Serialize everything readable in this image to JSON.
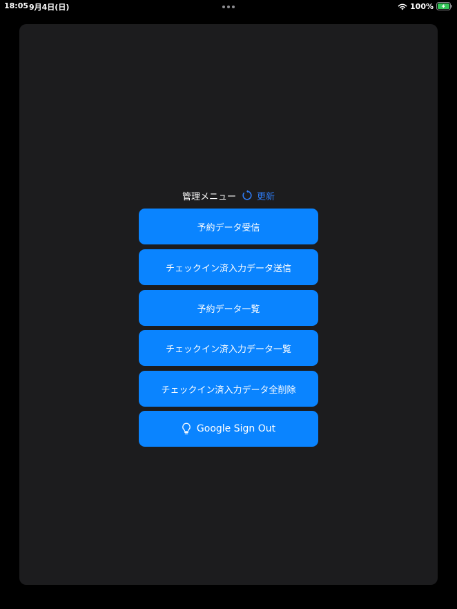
{
  "status_bar": {
    "time": "18:05",
    "date": "9月4日(日)",
    "battery": "100%",
    "icons": [
      "multitask-dots-icon",
      "wifi-icon",
      "battery-charging-icon"
    ]
  },
  "menu": {
    "title": "管理メニュー",
    "refresh_label": "更新",
    "refresh_icon": "refresh-icon"
  },
  "buttons": [
    {
      "label": "予約データ受信"
    },
    {
      "label": "チェックイン済入力データ送信"
    },
    {
      "label": "予約データ一覧"
    },
    {
      "label": "チェックイン済入力データ一覧"
    },
    {
      "label": "チェックイン済入力データ全削除"
    },
    {
      "label": "Google Sign Out",
      "icon": "lightbulb-icon"
    }
  ],
  "colors": {
    "background": "#000000",
    "panel": "#1c1c1e",
    "button": "#0a84ff",
    "accent_link": "#2e7cf6",
    "battery_green": "#34c759"
  }
}
